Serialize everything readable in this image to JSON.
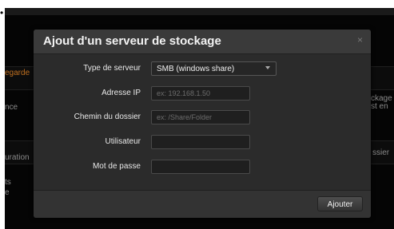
{
  "background": {
    "bullet": "•",
    "left_texts": [
      "egarde",
      "nce",
      "uration",
      "ts",
      "e"
    ],
    "right_texts": [
      "ckage",
      "st en",
      "ssier"
    ]
  },
  "modal": {
    "title": "Ajout d'un serveur de stockage",
    "close_glyph": "×",
    "fields": {
      "server_type": {
        "label": "Type de serveur",
        "value": "SMB (windows share)"
      },
      "ip_address": {
        "label": "Adresse IP",
        "placeholder": "ex: 192.168.1.50",
        "value": ""
      },
      "folder_path": {
        "label": "Chemin du dossier",
        "placeholder": "ex: /Share/Folder",
        "value": ""
      },
      "user": {
        "label": "Utilisateur",
        "placeholder": "",
        "value": ""
      },
      "password": {
        "label": "Mot de passe",
        "placeholder": "",
        "value": ""
      }
    },
    "submit_label": "Ajouter"
  },
  "colors": {
    "overlay": "#050505",
    "modal": "#2b2b2b",
    "header": "#3a3a3a",
    "accent_orange": "#c07020"
  }
}
